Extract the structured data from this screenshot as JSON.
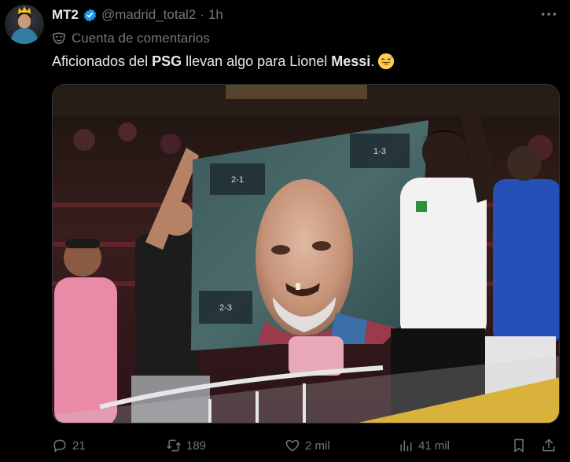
{
  "author": {
    "name": "MT2",
    "handle": "@madrid_total2",
    "separator": "·",
    "time": "1h"
  },
  "account_label": {
    "text": "Cuenta de comentarios",
    "icon": "mask-icon"
  },
  "tweet": {
    "text_part1": "Aficionados del ",
    "text_bold1": "PSG",
    "text_part2": " llevan algo para Lionel ",
    "text_bold2": "Messi",
    "text_part3": ".",
    "emoji": "grinning-sweat-emoji"
  },
  "banner_scores": {
    "top_left": "2-1",
    "top_right": "1-3",
    "bottom_left": "2-3"
  },
  "metrics": {
    "replies": "21",
    "reposts": "189",
    "likes": "2 mil",
    "views": "41 mil"
  },
  "colors": {
    "background": "#000000",
    "text": "#e7e9ea",
    "muted": "#71767b",
    "verified": "#1d9bf0"
  }
}
